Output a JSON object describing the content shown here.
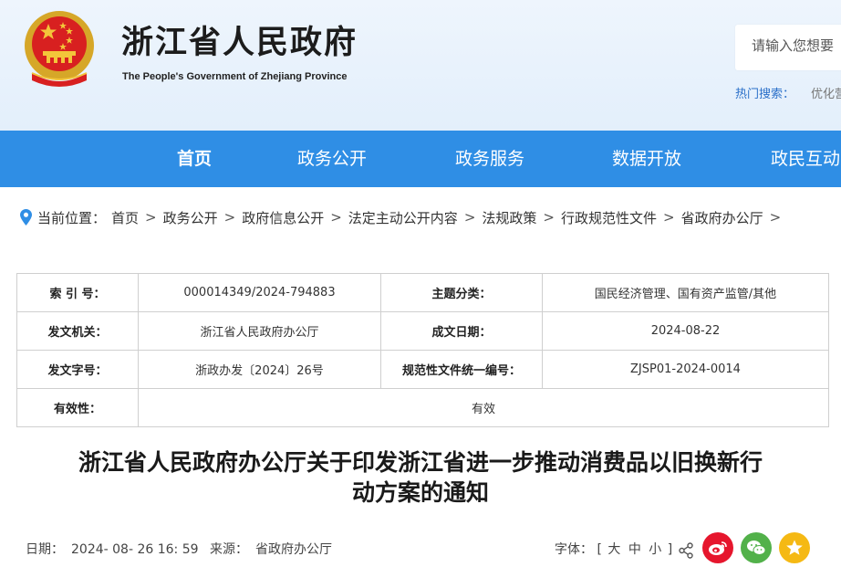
{
  "header": {
    "title": "浙江省人民政府",
    "subtitle": "The People's Government of Zhejiang Province",
    "search_placeholder": "请输入您想要",
    "hot_label": "热门搜索：",
    "hot_item": "优化营"
  },
  "nav": {
    "items": [
      "首页",
      "政务公开",
      "政务服务",
      "数据开放",
      "政民互动"
    ]
  },
  "breadcrumb": {
    "label": "当前位置：",
    "items": [
      "首页",
      "政务公开",
      "政府信息公开",
      "法定主动公开内容",
      "法规政策",
      "行政规范性文件",
      "省政府办公厅"
    ],
    "separator": ">"
  },
  "info": {
    "rows": [
      [
        "索 引 号：",
        "000014349/2024-794883",
        "主题分类：",
        "国民经济管理、国有资产监管/其他"
      ],
      [
        "发文机关：",
        "浙江省人民政府办公厅",
        "成文日期：",
        "2024-08-22"
      ],
      [
        "发文字号：",
        "浙政办发〔2024〕26号",
        "规范性文件统一编号：",
        "ZJSP01-2024-0014"
      ]
    ],
    "validity_label": "有效性：",
    "validity_value": "有效"
  },
  "article": {
    "title_line1": "浙江省人民政府办公厅关于印发浙江省进一步推动消费品以旧换新行",
    "title_line2": "动方案的通知"
  },
  "meta": {
    "date_label": "日期：",
    "date_value": "2024- 08- 26 16: 59",
    "source_label": "来源：",
    "source_value": "省政府办公厅",
    "font_label": "字体：",
    "font_open": "[",
    "font_large": "大",
    "font_medium": "中",
    "font_small": "小",
    "font_close": "]"
  },
  "share": {
    "icons": [
      "share-icon",
      "weibo-icon",
      "wechat-icon",
      "favorite-icon"
    ]
  },
  "colors": {
    "nav_bg": "#2f8ee5",
    "header_bg": "#e8f2fc",
    "weibo": "#e6162d",
    "wechat": "#52b14a",
    "favorite": "#f5b914"
  }
}
